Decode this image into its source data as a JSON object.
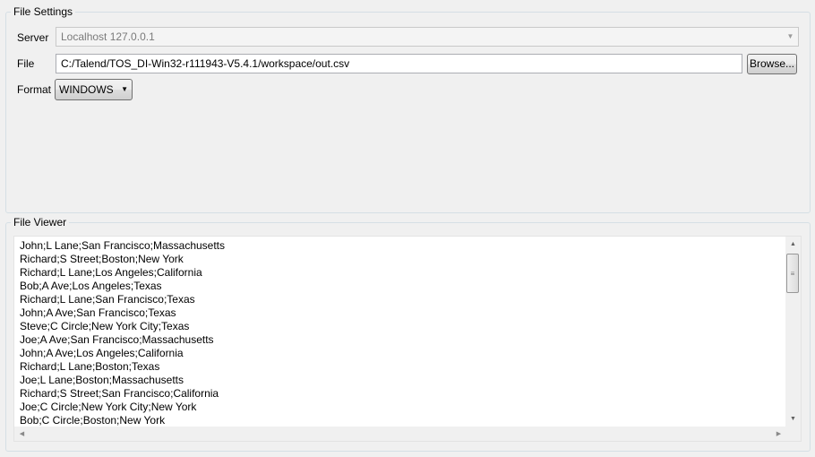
{
  "file_settings": {
    "title": "File Settings",
    "server_label": "Server",
    "server_value": "Localhost 127.0.0.1",
    "file_label": "File",
    "file_value": "C:/Talend/TOS_DI-Win32-r111943-V5.4.1/workspace/out.csv",
    "browse_label": "Browse...",
    "format_label": "Format",
    "format_value": "WINDOWS"
  },
  "file_viewer": {
    "title": "File Viewer",
    "lines": [
      "John;L Lane;San Francisco;Massachusetts",
      "Richard;S Street;Boston;New York",
      "Richard;L Lane;Los Angeles;California",
      "Bob;A Ave;Los Angeles;Texas",
      "Richard;L Lane;San Francisco;Texas",
      "John;A Ave;San Francisco;Texas",
      "Steve;C Circle;New York City;Texas",
      "Joe;A Ave;San Francisco;Massachusetts",
      "John;A Ave;Los Angeles;California",
      "Richard;L Lane;Boston;Texas",
      "Joe;L Lane;Boston;Massachusetts",
      "Richard;S Street;San Francisco;California",
      "Joe;C Circle;New York City;New York",
      "Bob;C Circle;Boston;New York"
    ]
  },
  "icons": {
    "dropdown_arrow": "chevron-down-icon",
    "scroll_up": "scroll-up-icon",
    "scroll_down": "scroll-down-icon",
    "scroll_left": "scroll-left-icon",
    "scroll_right": "scroll-right-icon"
  },
  "colors": {
    "background": "#f0f0f0",
    "group_border": "#d5dfe5",
    "input_border": "#abadb3"
  }
}
